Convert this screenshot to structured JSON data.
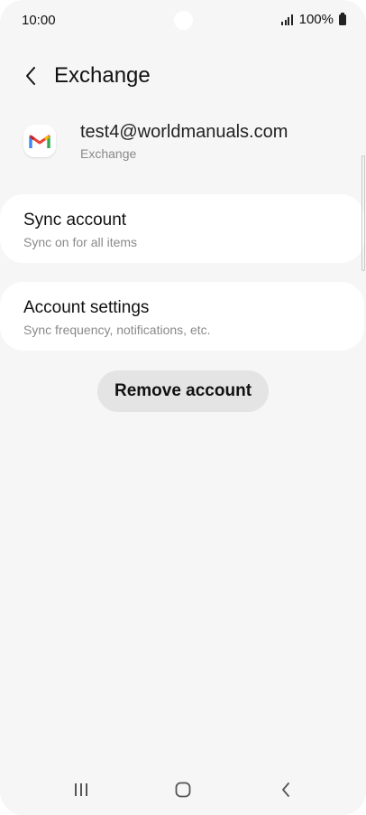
{
  "status_bar": {
    "time": "10:00",
    "battery_text": "100%"
  },
  "header": {
    "back_icon": "chevron-left-icon",
    "title": "Exchange"
  },
  "account": {
    "icon": "gmail-icon",
    "email": "test4@worldmanuals.com",
    "type": "Exchange"
  },
  "sync_card": {
    "title": "Sync account",
    "subtitle": "Sync on for all items"
  },
  "settings_card": {
    "title": "Account settings",
    "subtitle": "Sync frequency, notifications, etc."
  },
  "remove_button": {
    "label": "Remove account"
  },
  "nav_bar": {
    "recent_icon": "recent-apps-icon",
    "home_icon": "home-icon",
    "back_icon": "back-icon"
  },
  "colors": {
    "background": "#f6f6f6",
    "card": "#ffffff",
    "button": "#e4e4e4",
    "secondary_text": "#8a8a8a"
  }
}
